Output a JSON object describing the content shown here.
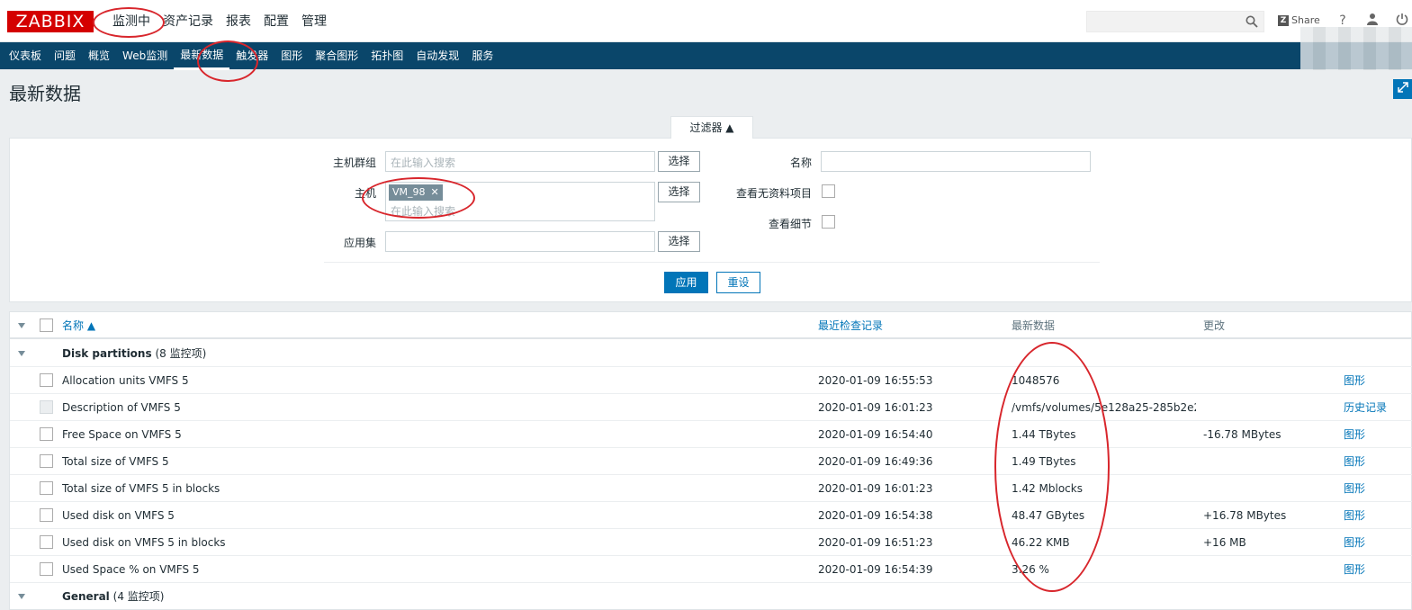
{
  "topbar": {
    "logo": "ZABBIX",
    "menu": [
      "监测中",
      "资产记录",
      "报表",
      "配置",
      "管理"
    ],
    "share": "Share",
    "help": "?",
    "user": "👤",
    "power": "⏻"
  },
  "submenu": [
    "仪表板",
    "问题",
    "概览",
    "Web监测",
    "最新数据",
    "触发器",
    "图形",
    "聚合图形",
    "拓扑图",
    "自动发现",
    "服务"
  ],
  "page_title": "最新数据",
  "filter": {
    "tab_label": "过滤器 ▲",
    "host_group_label": "主机群组",
    "host_group_placeholder": "在此输入搜索",
    "host_label": "主机",
    "host_tag": "VM_98",
    "host_placeholder": "在此输入搜索",
    "app_label": "应用集",
    "select_label": "选择",
    "name_label": "名称",
    "show_no_data_label": "查看无资料项目",
    "show_details_label": "查看细节",
    "apply_label": "应用",
    "reset_label": "重设"
  },
  "table": {
    "headers": {
      "name": "名称 ▲",
      "last_check": "最近检查记录",
      "last_value": "最新数据",
      "change": "更改"
    },
    "groups": [
      {
        "name": "Disk partitions",
        "count": "(8 监控项)",
        "rows": [
          {
            "name": "Allocation units VMFS 5",
            "time": "2020-01-09 16:55:53",
            "value": "1048576",
            "change": "",
            "action": "图形",
            "disabled": false
          },
          {
            "name": "Description of VMFS 5",
            "time": "2020-01-09 16:01:23",
            "value": "/vmfs/volumes/5e128a25-285b2e2…",
            "change": "",
            "action": "历史记录",
            "disabled": true
          },
          {
            "name": "Free Space on VMFS 5",
            "time": "2020-01-09 16:54:40",
            "value": "1.44 TBytes",
            "change": "-16.78 MBytes",
            "action": "图形",
            "disabled": false
          },
          {
            "name": "Total size of VMFS 5",
            "time": "2020-01-09 16:49:36",
            "value": "1.49 TBytes",
            "change": "",
            "action": "图形",
            "disabled": false
          },
          {
            "name": "Total size of VMFS 5 in blocks",
            "time": "2020-01-09 16:01:23",
            "value": "1.42 Mblocks",
            "change": "",
            "action": "图形",
            "disabled": false
          },
          {
            "name": "Used disk on VMFS 5",
            "time": "2020-01-09 16:54:38",
            "value": "48.47 GBytes",
            "change": "+16.78 MBytes",
            "action": "图形",
            "disabled": false
          },
          {
            "name": "Used disk on VMFS 5 in blocks",
            "time": "2020-01-09 16:51:23",
            "value": "46.22 KMB",
            "change": "+16 MB",
            "action": "图形",
            "disabled": false
          },
          {
            "name": "Used Space % on VMFS 5",
            "time": "2020-01-09 16:54:39",
            "value": "3.26 %",
            "change": "",
            "action": "图形",
            "disabled": false
          }
        ]
      },
      {
        "name": "General",
        "count": "(4 监控项)",
        "rows": []
      }
    ]
  },
  "colors": {
    "brand": "#d40000",
    "nav": "#0a466a",
    "link": "#0275b8",
    "annotation": "#d8262c"
  }
}
